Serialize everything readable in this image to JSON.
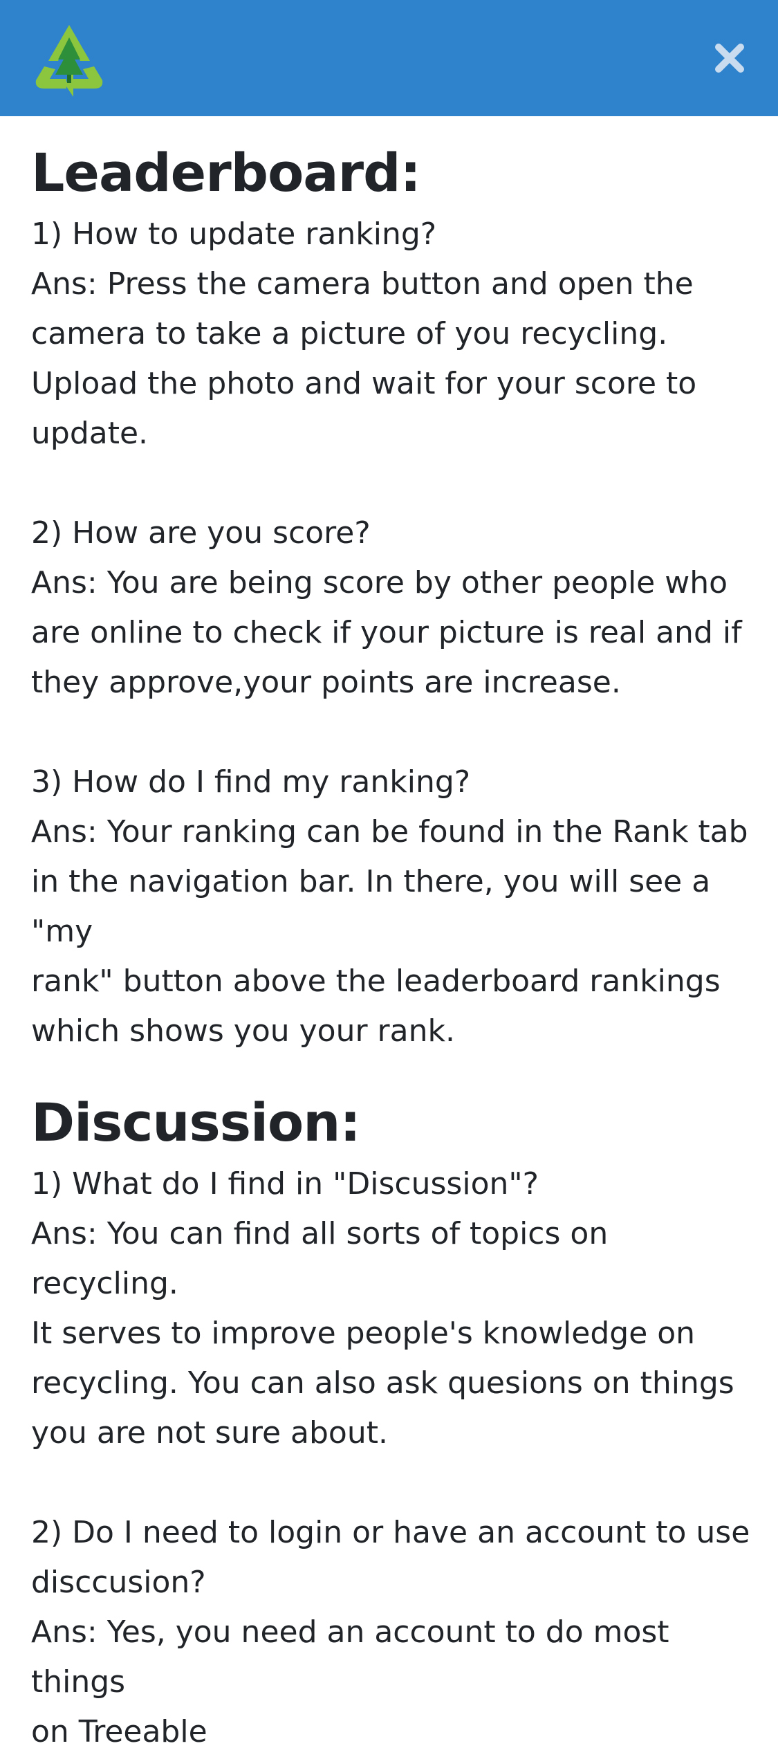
{
  "header": {
    "logo_icon": "recycle-tree-logo-icon",
    "close_icon": "close-icon",
    "background": "#2e83cc"
  },
  "leaderboard": {
    "title": "Leaderboard:",
    "items": [
      {
        "question": "1) How to update ranking?",
        "answer_lines": [
          "Ans: Press the camera button and open the",
          "camera to take a picture of you recycling.",
          "Upload the photo and wait for your score to",
          "update."
        ]
      },
      {
        "question": "2) How are you score?",
        "answer_lines": [
          "Ans: You are being score by other people who",
          "are online to check if your picture is real and if",
          "they approve,your points are increase."
        ]
      },
      {
        "question": "3) How do I find my ranking?",
        "answer_lines": [
          "Ans: Your ranking can be found in the Rank tab",
          "in the navigation bar. In there, you will see a \"my",
          "rank\" button above the leaderboard rankings",
          "which shows you your rank."
        ]
      }
    ]
  },
  "discussion": {
    "title": "Discussion:",
    "items": [
      {
        "question": "1) What do I find in \"Discussion\"?",
        "answer_lines": [
          "Ans: You can find all sorts of topics on recycling.",
          "It serves to improve people's knowledge on",
          "recycling. You can also ask quesions on things",
          "you are not sure about."
        ]
      },
      {
        "question_lines": [
          "2) Do I need to login or have an account to use",
          "disccusion?"
        ],
        "answer_lines": [
          "Ans: Yes, you need an account to do most things",
          "on Treeable"
        ]
      }
    ]
  }
}
